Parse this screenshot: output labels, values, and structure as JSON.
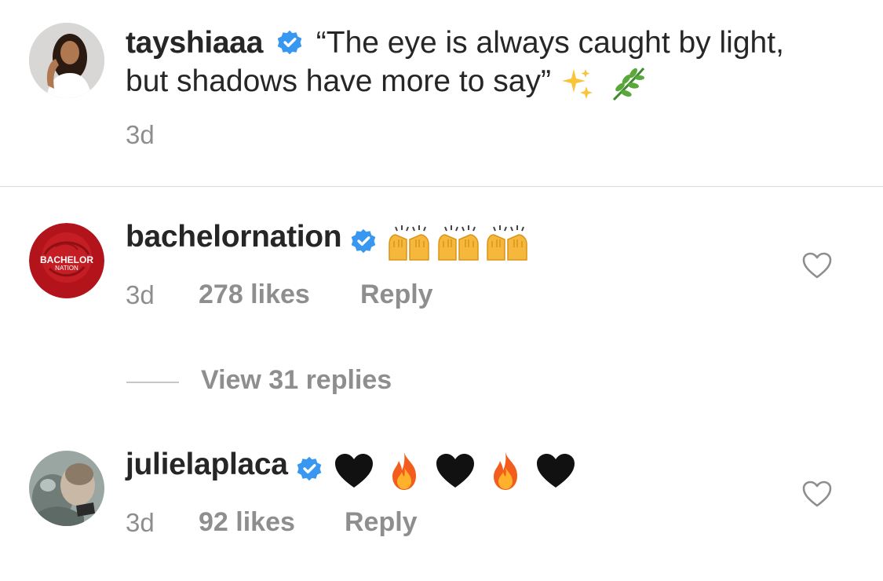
{
  "caption": {
    "username": "tayshiaaa",
    "line1": "“The eye is always caught by light,",
    "line2": "but shadows have more to say”",
    "timestamp": "3d",
    "emojis": [
      "sparkles-emoji",
      "herb-emoji"
    ]
  },
  "comments": [
    {
      "username": "bachelornation",
      "avatar_text_1": "BACHELOR",
      "avatar_text_2": "NATION",
      "emojis": [
        "raising-hands-emoji",
        "raising-hands-emoji",
        "raising-hands-emoji"
      ],
      "timestamp": "3d",
      "likes": "278 likes",
      "reply_label": "Reply",
      "view_replies": "View 31 replies"
    },
    {
      "username": "julielaplaca",
      "emojis": [
        "black-heart-emoji",
        "fire-emoji",
        "black-heart-emoji",
        "fire-emoji",
        "black-heart-emoji"
      ],
      "timestamp": "3d",
      "likes": "92 likes",
      "reply_label": "Reply"
    }
  ],
  "colors": {
    "text": "#262626",
    "muted": "#8e8e8e",
    "verified": "#3897f0",
    "divider": "#dbdbdb"
  }
}
